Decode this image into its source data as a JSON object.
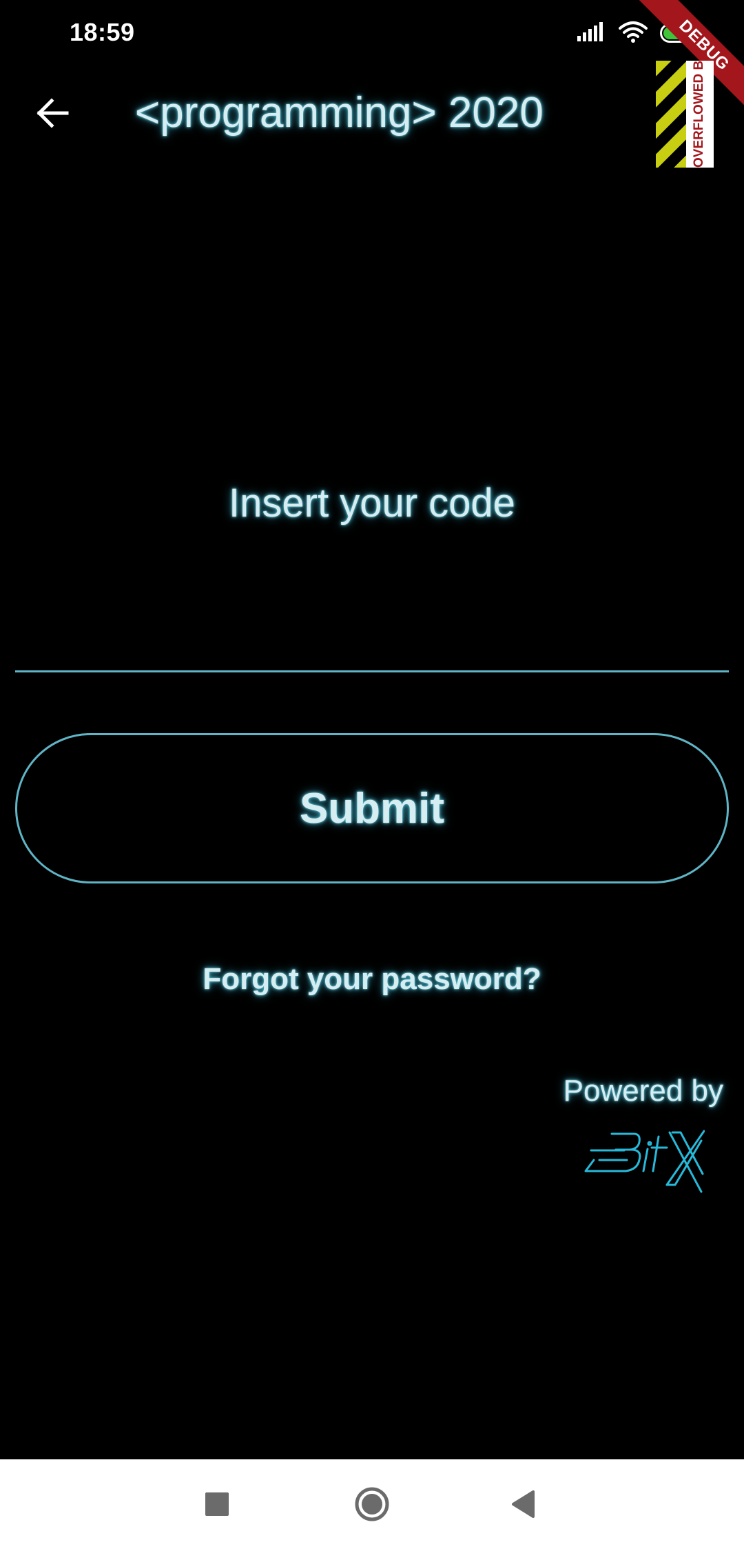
{
  "status_bar": {
    "time": "18:59",
    "battery_level": "76",
    "battery_fraction": 0.76,
    "icons": [
      "signal-icon",
      "wifi-icon",
      "battery-icon"
    ]
  },
  "debug_banner": {
    "label": "DEBUG",
    "overflow_label": "OVERFLOWED BY"
  },
  "app_bar": {
    "back_icon": "arrow-left-icon",
    "title": "<programming> 2020"
  },
  "form": {
    "prompt": "Insert your code",
    "code_value": "",
    "code_placeholder": "",
    "submit_label": "Submit",
    "forgot_label": "Forgot your password?"
  },
  "footer": {
    "powered_by": "Powered by",
    "brand_logo": "bitx-logo"
  },
  "nav_bar": {
    "items": [
      "recents-square-icon",
      "home-circle-icon",
      "back-triangle-icon"
    ]
  },
  "colors": {
    "background": "#000000",
    "accent": "#5fb4c5",
    "glow_text": "#d6edf2",
    "logo": "#27b9d9",
    "debug_red": "#a3161c",
    "overflow_yellow": "#c8cf12",
    "battery_green": "#3fc43a"
  }
}
